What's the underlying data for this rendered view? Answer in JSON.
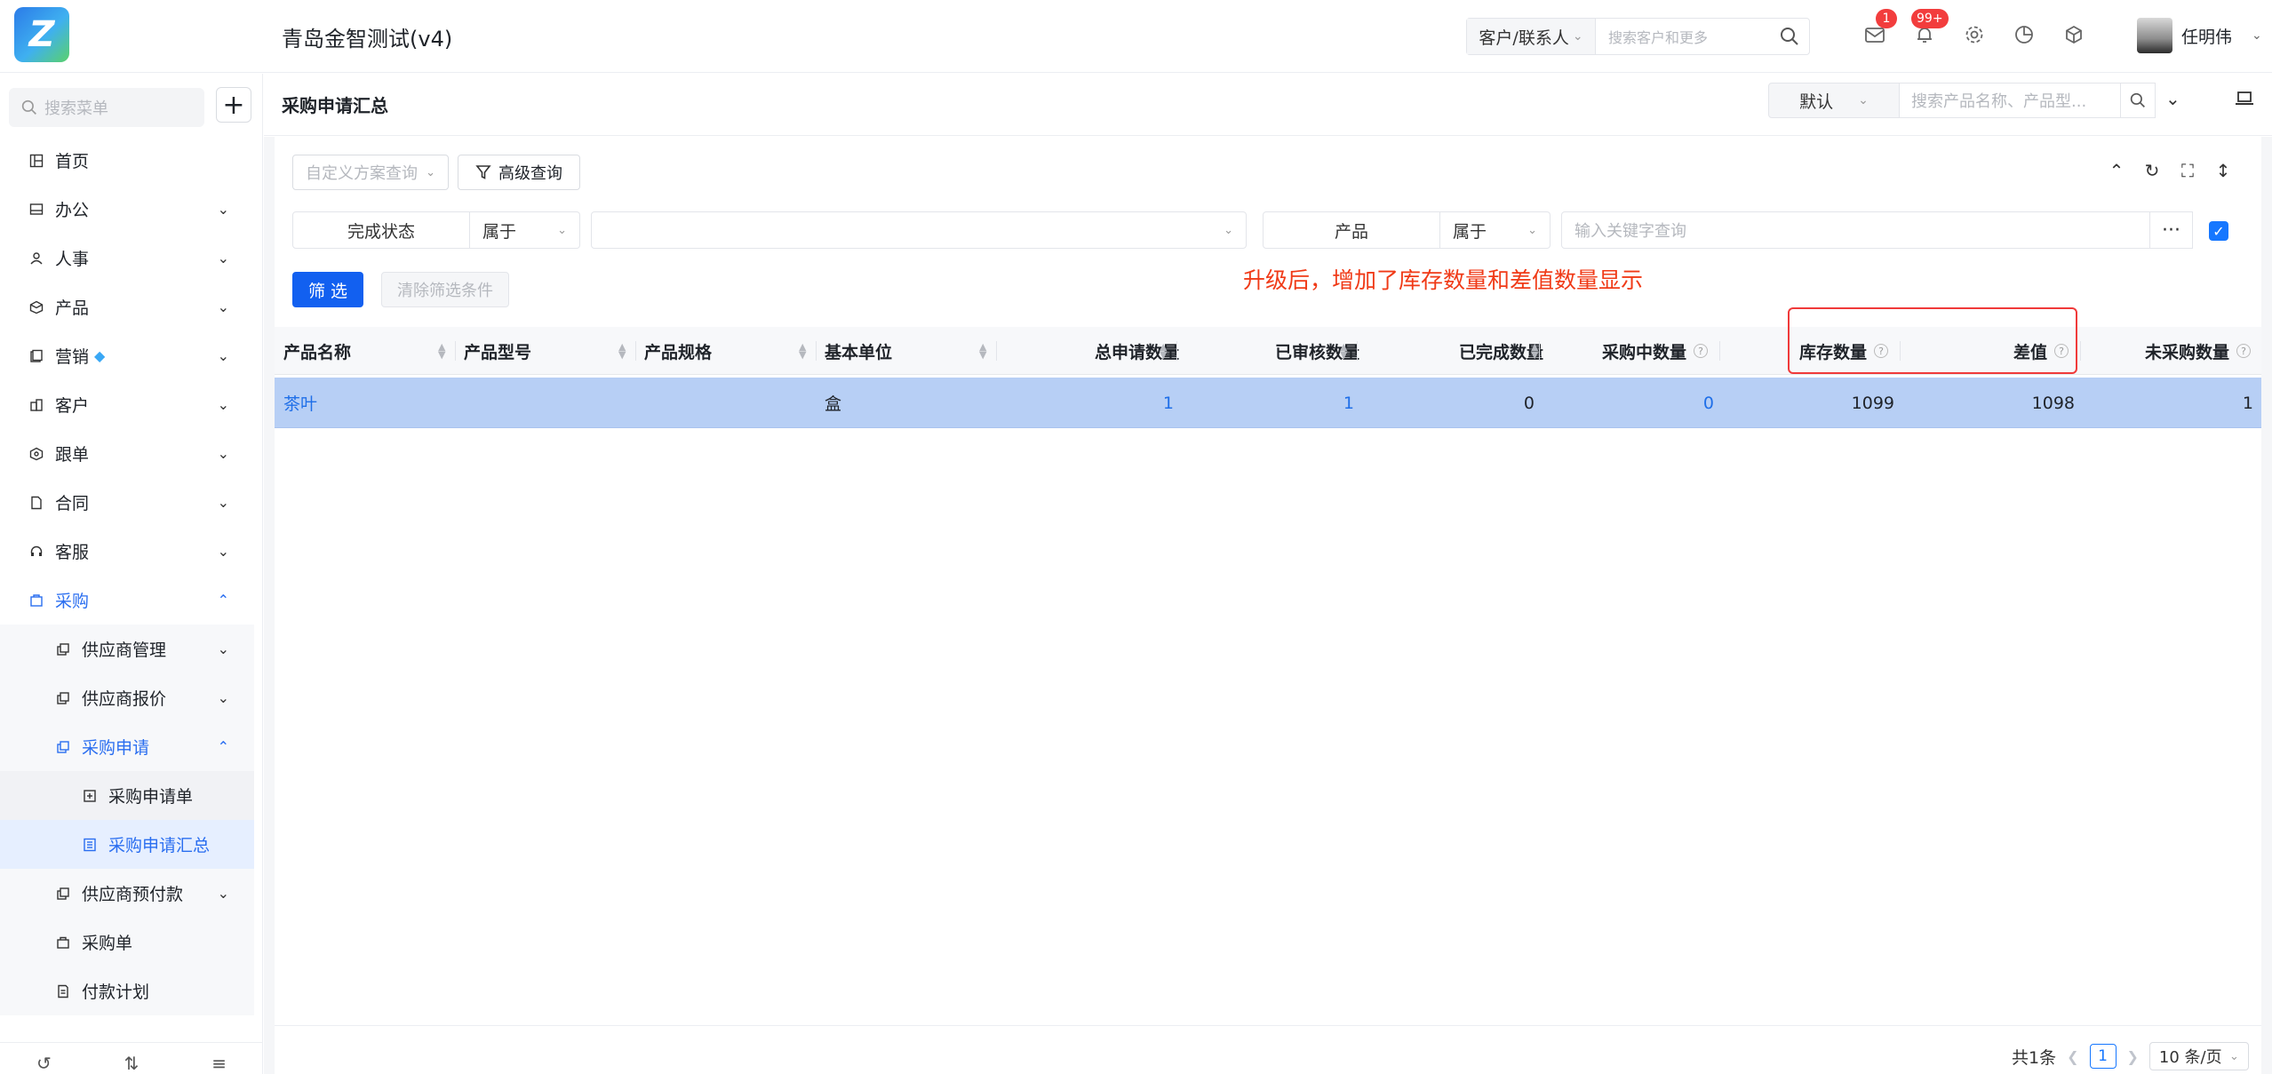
{
  "app": {
    "title": "青岛金智测试(v4)",
    "logo_text": "Z"
  },
  "topbar": {
    "search_scope": "客户/联系人",
    "search_placeholder": "搜索客户和更多",
    "mail_badge": "1",
    "notice_badge": "99+",
    "user_name": "任明伟",
    "icons": [
      "search-icon",
      "mail-icon",
      "bell-icon",
      "gear-icon",
      "pie-chart-icon",
      "cube-icon"
    ]
  },
  "sidebar": {
    "search_placeholder": "搜索菜单",
    "add_label": "+",
    "items": [
      {
        "label": "首页",
        "icon": "home-icon"
      },
      {
        "label": "办公",
        "icon": "office-icon"
      },
      {
        "label": "人事",
        "icon": "people-icon"
      },
      {
        "label": "产品",
        "icon": "box-icon"
      },
      {
        "label": "营销",
        "icon": "marketing-icon"
      },
      {
        "label": "客户",
        "icon": "customer-icon"
      },
      {
        "label": "跟单",
        "icon": "follow-icon"
      },
      {
        "label": "合同",
        "icon": "contract-icon"
      },
      {
        "label": "客服",
        "icon": "headset-icon"
      },
      {
        "label": "采购",
        "icon": "purchase-icon"
      }
    ],
    "purchase_children": [
      {
        "label": "供应商管理"
      },
      {
        "label": "供应商报价"
      },
      {
        "label": "采购申请"
      }
    ],
    "apply_children": [
      {
        "label": "采购申请单"
      },
      {
        "label": "采购申请汇总"
      }
    ],
    "purchase_more": [
      {
        "label": "供应商预付款"
      },
      {
        "label": "采购单"
      },
      {
        "label": "付款计划"
      }
    ]
  },
  "header": {
    "page_title": "采购申请汇总",
    "view_select": "默认",
    "product_search_placeholder": "搜索产品名称、产品型..."
  },
  "toolbar": {
    "scheme_placeholder": "自定义方案查询",
    "advanced_label": "高级查询"
  },
  "filters": {
    "f1_label": "完成状态",
    "f1_op": "属于",
    "f2_label": "产品",
    "f2_op": "属于",
    "keyword_placeholder": "输入关键字查询",
    "more_label": "···",
    "filter_btn": "筛 选",
    "clear_btn": "清除筛选条件"
  },
  "annotation": "升级后，增加了库存数量和差值数量显示",
  "table": {
    "columns": [
      "产品名称",
      "产品型号",
      "产品规格",
      "基本单位",
      "总申请数量",
      "已审核数量",
      "已完成数量",
      "采购中数量",
      "库存数量",
      "差值",
      "未采购数量"
    ],
    "rows": [
      {
        "name": "茶叶",
        "model": "",
        "spec": "",
        "unit": "盒",
        "total": "1",
        "approved": "1",
        "completed": "0",
        "purchasing": "0",
        "stock": "1099",
        "diff": "1098",
        "unpurchased": "1"
      }
    ]
  },
  "pager": {
    "total": "共1条",
    "page": "1",
    "size": "10 条/页"
  },
  "colors": {
    "primary": "#1260f0",
    "annotation": "#f03a17",
    "selected_row": "#b7cff5"
  }
}
